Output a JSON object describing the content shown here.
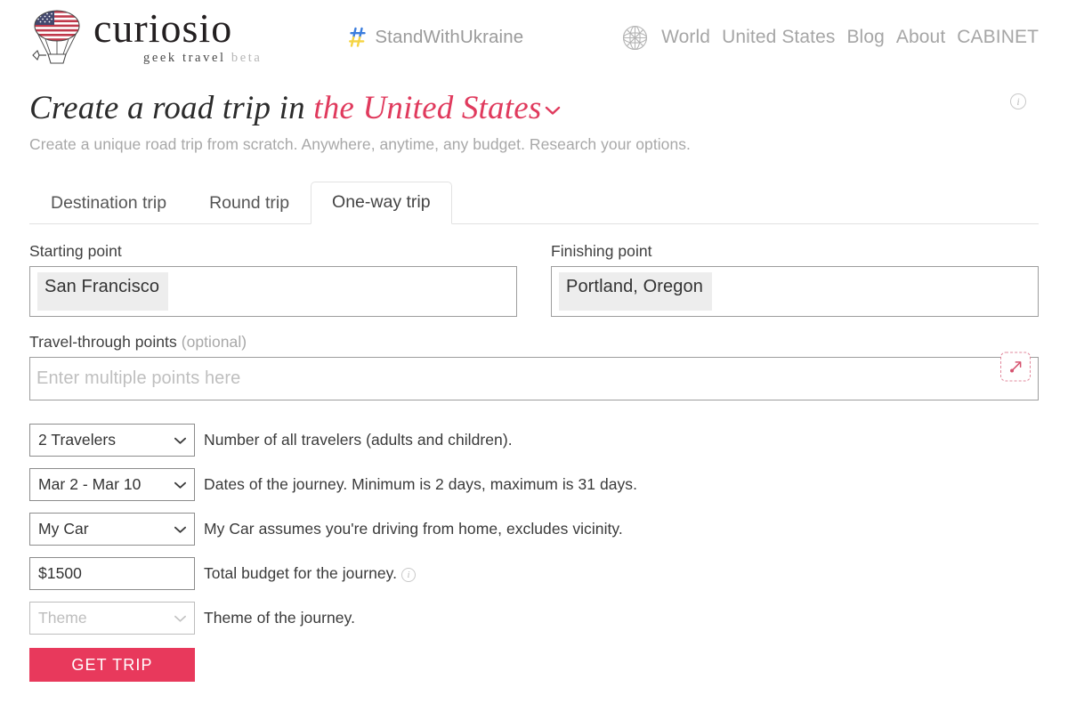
{
  "header": {
    "brand_name": "curiosio",
    "brand_tagline": "geek travel",
    "brand_beta": "beta",
    "ukraine_label": "StandWithUkraine",
    "nav": [
      {
        "label": "World"
      },
      {
        "label": "United States"
      },
      {
        "label": "Blog"
      },
      {
        "label": "About"
      },
      {
        "label": "CABINET"
      }
    ]
  },
  "title": {
    "lead": "Create a road trip in ",
    "country": "the United States",
    "subtitle": "Create a unique road trip from scratch. Anywhere, anytime, any budget. Research your options."
  },
  "tabs": [
    {
      "label": "Destination trip",
      "active": false
    },
    {
      "label": "Round trip",
      "active": false
    },
    {
      "label": "One-way trip",
      "active": true
    }
  ],
  "form": {
    "starting_point": {
      "label": "Starting point",
      "value": "San Francisco"
    },
    "finishing_point": {
      "label": "Finishing point",
      "value": "Portland, Oregon"
    },
    "through_points": {
      "label": "Travel-through points ",
      "optional": "(optional)",
      "placeholder": "Enter multiple points here"
    },
    "options": [
      {
        "value": "2 Travelers",
        "help": "Number of all travelers (adults and children)."
      },
      {
        "value": "Mar 2 - Mar 10",
        "help": "Dates of the journey. Minimum is 2 days, maximum is 31 days."
      },
      {
        "value": "My Car",
        "help": "My Car assumes you're driving from home, excludes vicinity."
      },
      {
        "value": "$1500",
        "help": "Total budget for the journey."
      },
      {
        "value": "Theme",
        "help": "Theme of the journey."
      }
    ],
    "submit_label": "GET TRIP"
  },
  "colors": {
    "accent": "#e8395c",
    "title_accent": "#e03a5d",
    "ukraine_blue": "#3b7ddd",
    "ukraine_yellow": "#f5d442",
    "border": "#9d9d9d"
  }
}
